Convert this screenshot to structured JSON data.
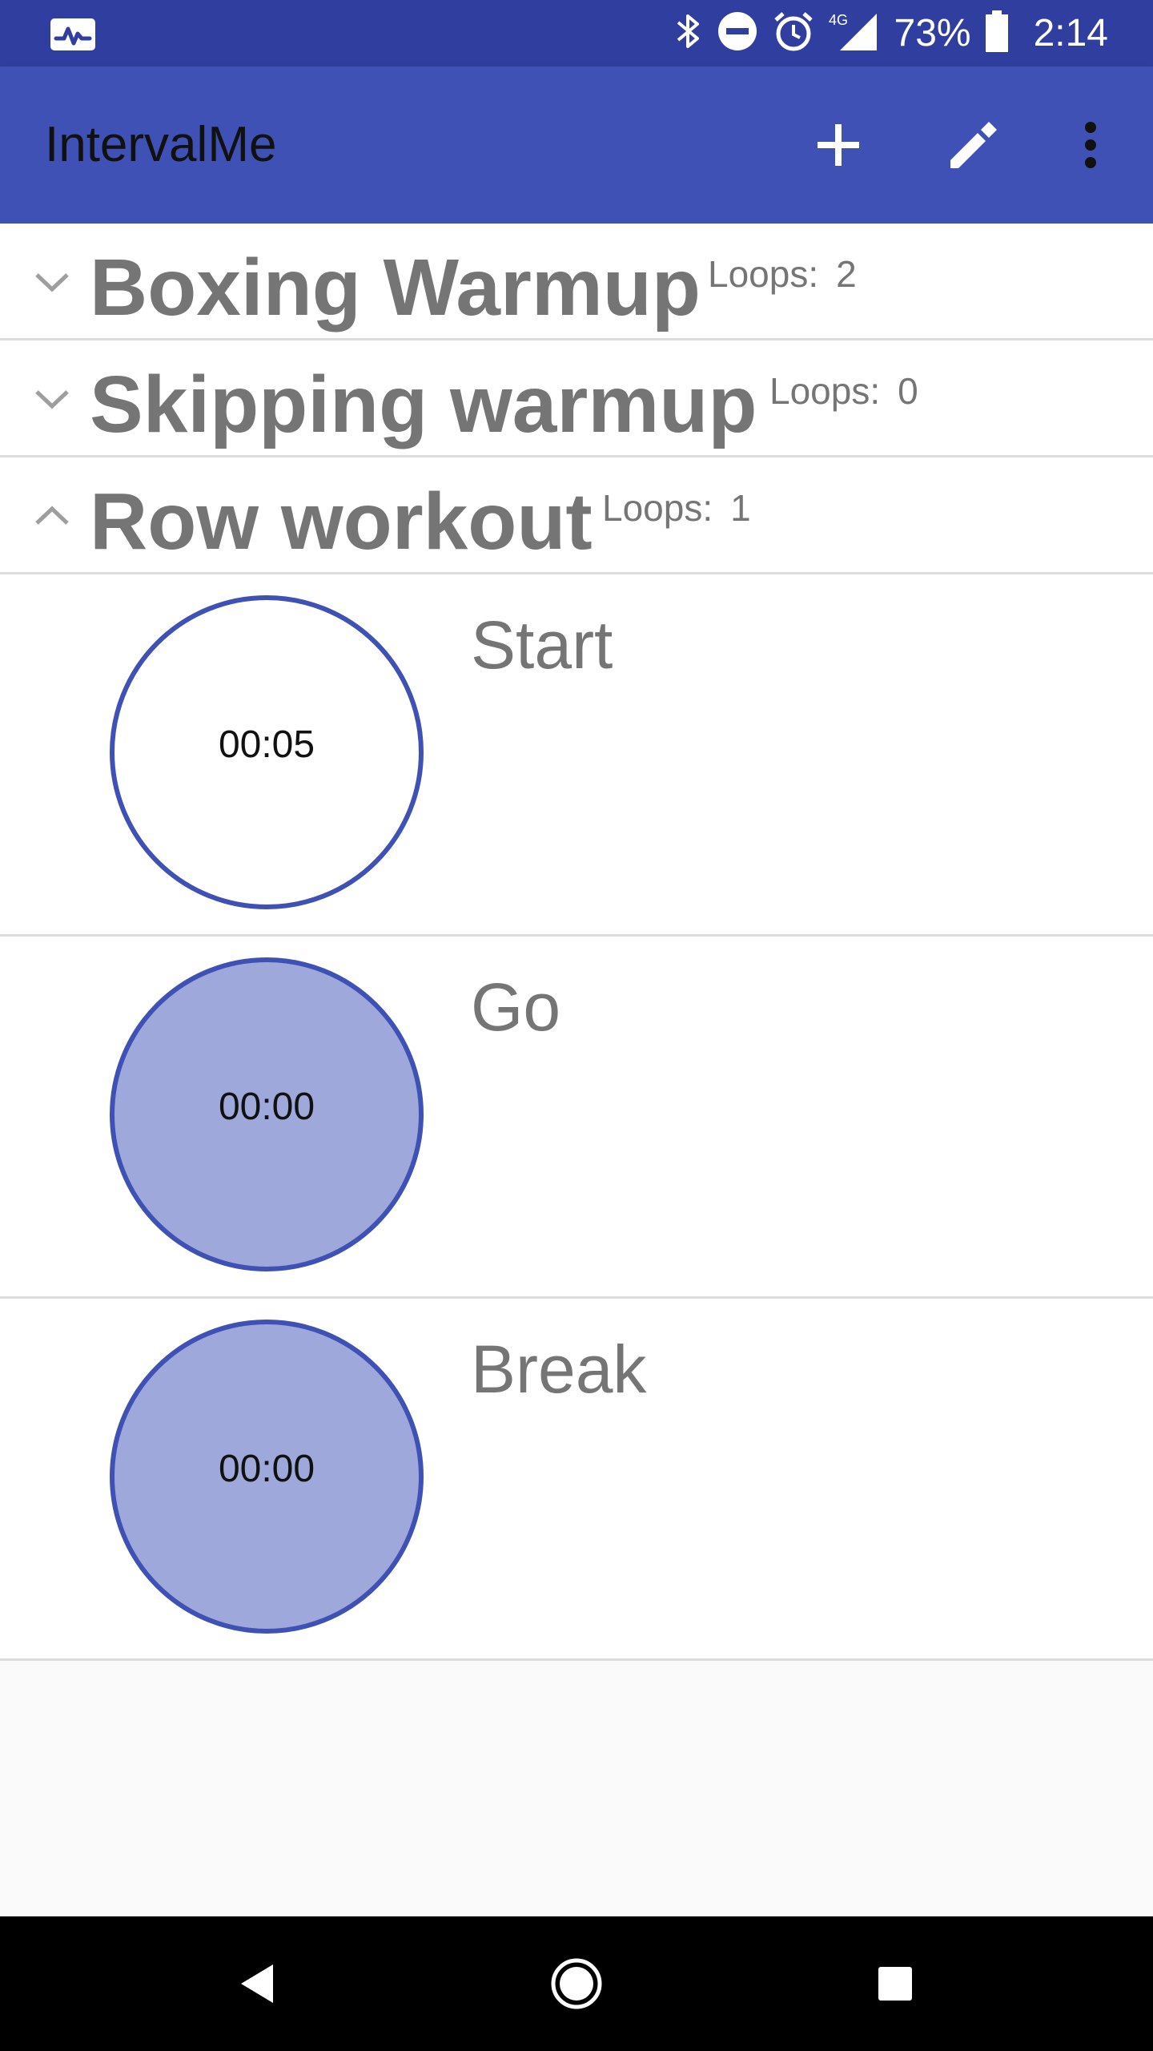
{
  "status_bar": {
    "battery": "73%",
    "time": "2:14",
    "network": "4G",
    "icons": [
      "pulse-app-icon",
      "bluetooth-icon",
      "do-not-disturb-icon",
      "alarm-icon",
      "signal-icon",
      "battery-icon"
    ]
  },
  "app_bar": {
    "title": "IntervalMe",
    "actions": [
      "add-icon",
      "edit-icon",
      "more-vert-icon"
    ]
  },
  "groups": [
    {
      "title": "Boxing Warmup",
      "loops_label": "Loops:",
      "loops": "2",
      "expanded": false
    },
    {
      "title": "Skipping warmup",
      "loops_label": "Loops:",
      "loops": "0",
      "expanded": false
    },
    {
      "title": "Row workout",
      "loops_label": "Loops:",
      "loops": "1",
      "expanded": true
    }
  ],
  "intervals": [
    {
      "name": "Start",
      "time": "00:05"
    },
    {
      "name": "Go",
      "time": "00:00"
    },
    {
      "name": "Break",
      "time": "00:00"
    }
  ],
  "nav_bar": {
    "buttons": [
      "back-icon",
      "home-icon",
      "recents-icon"
    ]
  },
  "colors": {
    "status_bar": "#303f9f",
    "app_bar": "#3f51b5",
    "accent_circle_fill": "#9fa8da",
    "text_gray": "#757575"
  }
}
